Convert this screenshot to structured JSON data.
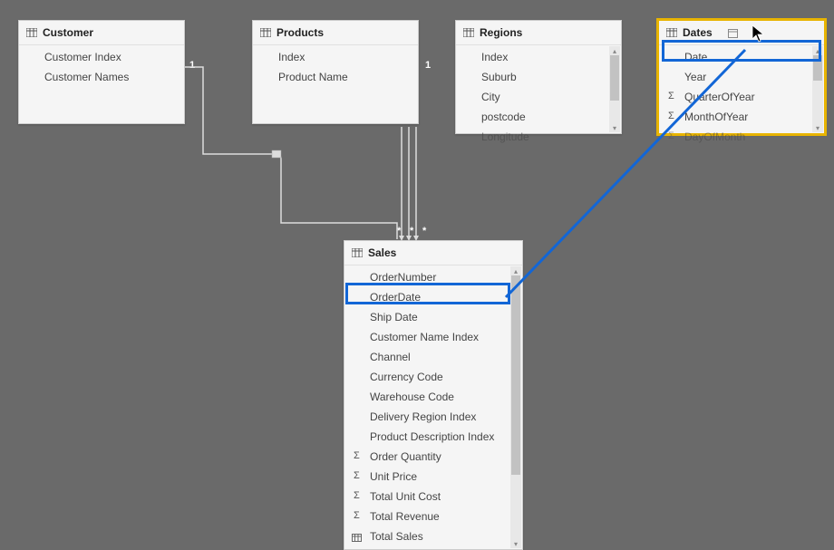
{
  "tables": {
    "customer": {
      "title": "Customer",
      "fields": [
        "Customer Index",
        "Customer Names"
      ]
    },
    "products": {
      "title": "Products",
      "fields": [
        "Index",
        "Product Name"
      ]
    },
    "regions": {
      "title": "Regions",
      "fields": [
        "Index",
        "Suburb",
        "City",
        "postcode",
        "Longitude"
      ]
    },
    "dates": {
      "title": "Dates",
      "fields": [
        {
          "label": "Date",
          "icon": "none"
        },
        {
          "label": "Year",
          "icon": "none"
        },
        {
          "label": "QuarterOfYear",
          "icon": "sigma"
        },
        {
          "label": "MonthOfYear",
          "icon": "sigma"
        },
        {
          "label": "DayOfMonth",
          "icon": "sigma"
        }
      ]
    },
    "sales": {
      "title": "Sales",
      "fields": [
        {
          "label": "OrderNumber",
          "icon": "none"
        },
        {
          "label": "OrderDate",
          "icon": "none"
        },
        {
          "label": "Ship Date",
          "icon": "none"
        },
        {
          "label": "Customer Name Index",
          "icon": "none"
        },
        {
          "label": "Channel",
          "icon": "none"
        },
        {
          "label": "Currency Code",
          "icon": "none"
        },
        {
          "label": "Warehouse Code",
          "icon": "none"
        },
        {
          "label": "Delivery Region Index",
          "icon": "none"
        },
        {
          "label": "Product Description Index",
          "icon": "none"
        },
        {
          "label": "Order Quantity",
          "icon": "sigma"
        },
        {
          "label": "Unit Price",
          "icon": "sigma"
        },
        {
          "label": "Total Unit Cost",
          "icon": "sigma"
        },
        {
          "label": "Total Revenue",
          "icon": "sigma"
        },
        {
          "label": "Total Sales",
          "icon": "table"
        }
      ]
    }
  },
  "relationship_markers": {
    "one_a": "1",
    "one_b": "1",
    "star_a": "*",
    "star_b": "*",
    "star_c": "*"
  }
}
